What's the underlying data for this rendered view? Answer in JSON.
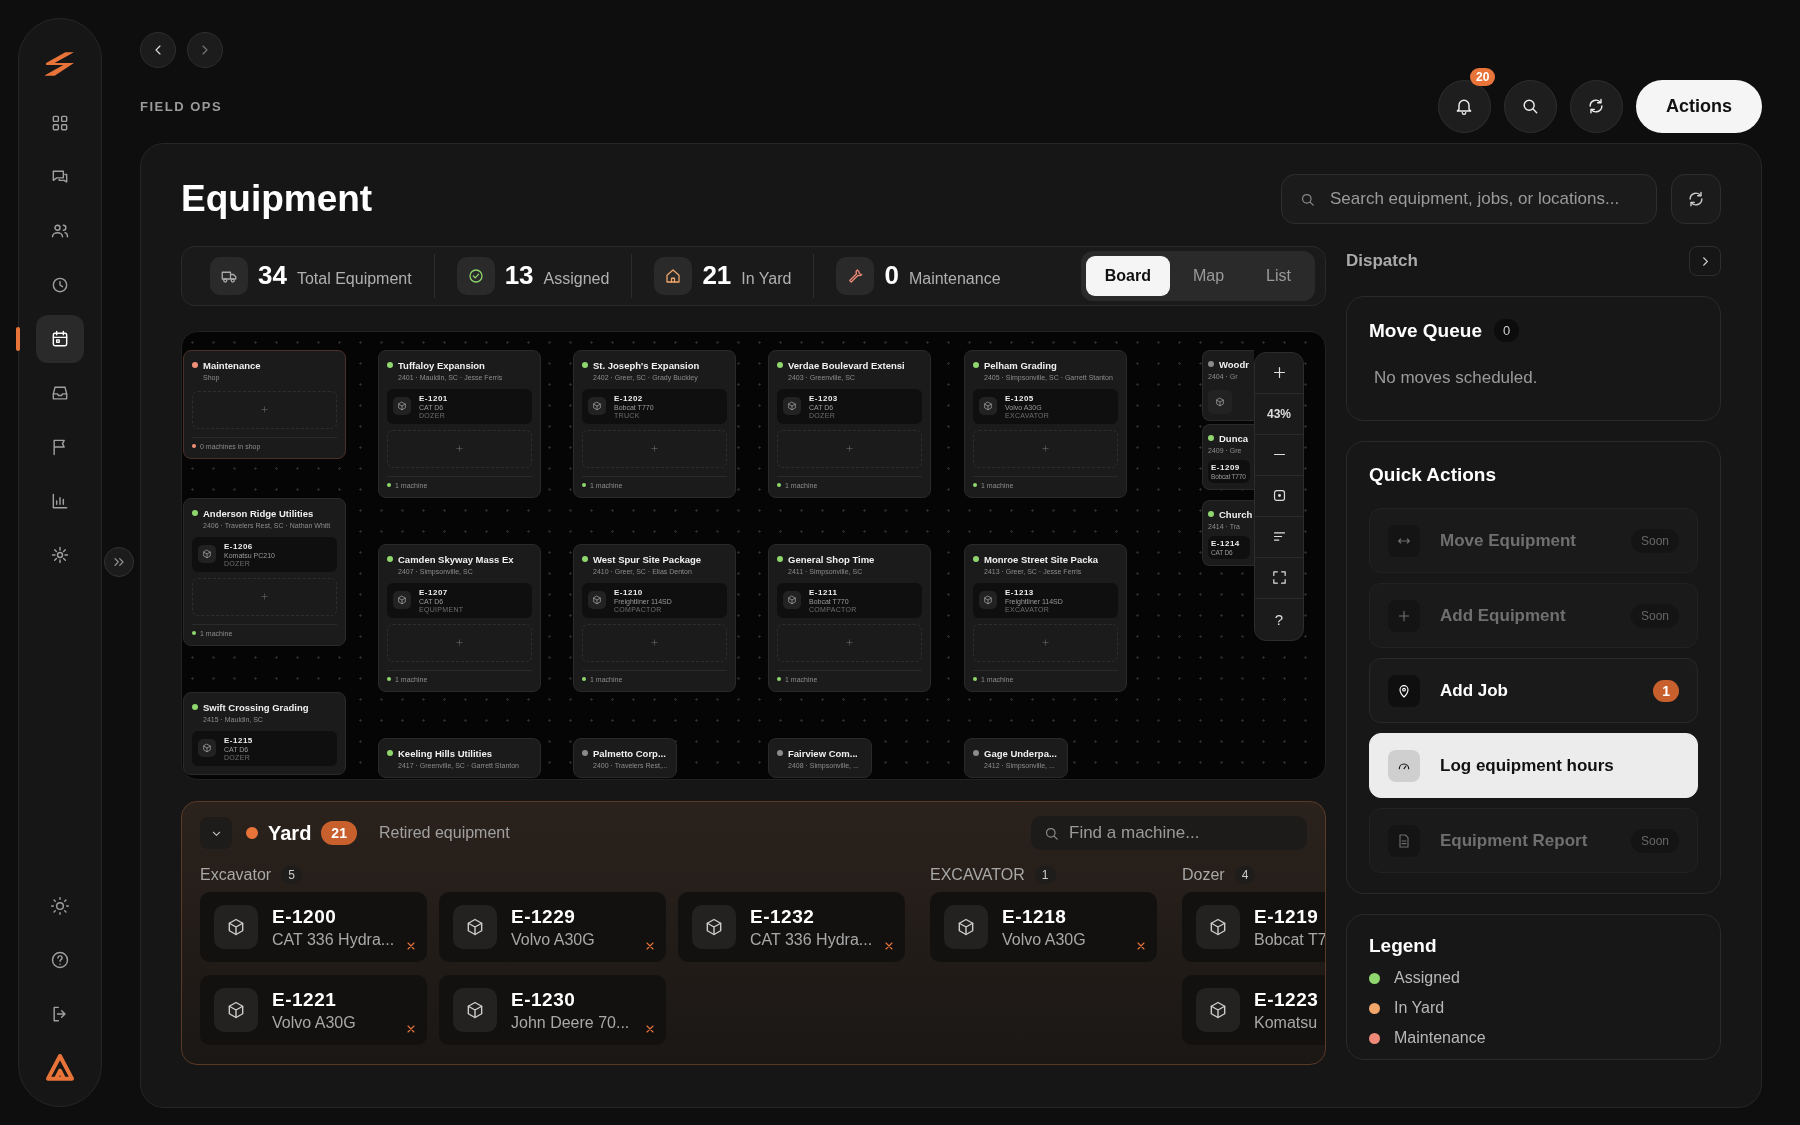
{
  "sidebar": {
    "items": [
      {
        "selected": false
      },
      {
        "selected": false
      },
      {
        "selected": false
      },
      {
        "selected": false
      },
      {
        "selected": true
      },
      {
        "selected": false
      },
      {
        "selected": false
      },
      {
        "selected": false
      },
      {
        "selected": false
      }
    ]
  },
  "section_label": "FIELD OPS",
  "header_actions": {
    "notifications_badge": "20",
    "primary_button": "Actions"
  },
  "page": {
    "title": "Equipment",
    "search": {
      "placeholder": "Search equipment, jobs, or locations..."
    }
  },
  "stats": [
    {
      "value": "34",
      "label": "Total Equipment"
    },
    {
      "value": "13",
      "label": "Assigned"
    },
    {
      "value": "21",
      "label": "In Yard"
    },
    {
      "value": "0",
      "label": "Maintenance"
    }
  ],
  "view_tabs": [
    {
      "label": "Board",
      "selected": true
    },
    {
      "label": "Map",
      "selected": false
    },
    {
      "label": "List",
      "selected": false
    }
  ],
  "board": {
    "zoom": "43%",
    "help": "?",
    "cards": [
      {
        "kind": "shop",
        "title": "Maintenance",
        "subtitle": "Shop",
        "color": "#f0907a",
        "footer": "0 machines in shop"
      },
      {
        "kind": "job",
        "title": "Tuffaloy Expansion",
        "subtitle": "2401 · Mauldin, SC · Jesse Ferris",
        "color": "#8fd66e",
        "machines": [
          {
            "id": "E-1201",
            "model": "CAT D6",
            "type": "DOZER"
          }
        ],
        "footer": "1 machine"
      },
      {
        "kind": "job",
        "title": "St. Joseph's Expansion",
        "subtitle": "2402 · Greer, SC · Grady Buckley",
        "color": "#8fd66e",
        "machines": [
          {
            "id": "E-1202",
            "model": "Bobcat T770",
            "type": "TRUCK"
          }
        ],
        "footer": "1 machine"
      },
      {
        "kind": "job",
        "title": "Verdae Boulevard Extensi",
        "subtitle": "2403 · Greenville, SC",
        "color": "#8fd66e",
        "machines": [
          {
            "id": "E-1203",
            "model": "CAT D6",
            "type": "DOZER"
          }
        ],
        "footer": "1 machine"
      },
      {
        "kind": "job",
        "title": "Pelham Grading",
        "subtitle": "2405 · Simpsonville, SC · Garrett Stanton",
        "color": "#8fd66e",
        "machines": [
          {
            "id": "E-1205",
            "model": "Volvo A30G",
            "type": "EXCAVATOR"
          }
        ],
        "footer": "1 machine"
      },
      {
        "kind": "compact",
        "title": "Woodr",
        "subtitle": "2404 · Gr",
        "color": "#8a8a8a"
      },
      {
        "kind": "job",
        "title": "Anderson Ridge Utilities",
        "subtitle": "2406 · Travelers Rest, SC · Nathan Whitt",
        "color": "#8fd66e",
        "machines": [
          {
            "id": "E-1206",
            "model": "Komatsu PC210",
            "type": "DOZER"
          }
        ],
        "footer": "1 machine"
      },
      {
        "kind": "compact",
        "title": "Dunca",
        "subtitle": "2409 · Gre",
        "color": "#8fd66e",
        "machines": [
          {
            "id": "E-1209",
            "model": "Bobcat T770"
          }
        ]
      },
      {
        "kind": "compact",
        "title": "Church",
        "subtitle": "2414 · Tra",
        "color": "#8fd66e",
        "machines": [
          {
            "id": "E-1214",
            "model": "CAT D6"
          }
        ]
      },
      {
        "kind": "job",
        "title": "Camden Skyway Mass Ex",
        "subtitle": "2407 · Simpsonville, SC",
        "color": "#8fd66e",
        "machines": [
          {
            "id": "E-1207",
            "model": "CAT D6",
            "type": "EQUIPMENT"
          }
        ],
        "footer": "1 machine"
      },
      {
        "kind": "job",
        "title": "West Spur Site Package",
        "subtitle": "2410 · Greer, SC · Elias Denton",
        "color": "#8fd66e",
        "machines": [
          {
            "id": "E-1210",
            "model": "Freightliner 114SD",
            "type": "COMPACTOR"
          }
        ],
        "footer": "1 machine"
      },
      {
        "kind": "job",
        "title": "General Shop Time",
        "subtitle": "2411 · Simpsonville, SC",
        "color": "#8fd66e",
        "machines": [
          {
            "id": "E-1211",
            "model": "Bobcat T770",
            "type": "COMPACTOR"
          }
        ],
        "footer": "1 machine"
      },
      {
        "kind": "job",
        "title": "Monroe Street Site Packa",
        "subtitle": "2413 · Greer, SC · Jesse Ferris",
        "color": "#8fd66e",
        "machines": [
          {
            "id": "E-1213",
            "model": "Freightliner 114SD",
            "type": "EXCAVATOR"
          }
        ],
        "footer": "1 machine"
      },
      {
        "kind": "stub",
        "title": "Swift Crossing Grading",
        "subtitle": "2415 · Mauldin, SC",
        "color": "#8fd66e",
        "machines": [
          {
            "id": "E-1215",
            "model": "CAT D6",
            "type": "DOZER"
          }
        ]
      },
      {
        "kind": "stub",
        "title": "Keeling Hills Utilities",
        "subtitle": "2417 · Greenville, SC · Garrett Stanton",
        "color": "#8fd66e"
      },
      {
        "kind": "stub",
        "title": "Palmetto Corp...",
        "subtitle": "2400 · Travelers Rest,...",
        "color": "#8a8a8a"
      },
      {
        "kind": "stub",
        "title": "Fairview Com...",
        "subtitle": "2408 · Simpsonville, ...",
        "color": "#8a8a8a"
      },
      {
        "kind": "stub",
        "title": "Gage Underpa...",
        "subtitle": "2412 · Simpsonville, ...",
        "color": "#8a8a8a"
      }
    ]
  },
  "yard": {
    "title": "Yard",
    "count": "21",
    "expanded": true,
    "link": "Retired equipment",
    "search": {
      "placeholder": "Find a machine..."
    },
    "groups": [
      {
        "name": "Excavator",
        "count": "5",
        "items": [
          {
            "id": "E-1200",
            "model": "CAT 336 Hydra..."
          },
          {
            "id": "E-1229",
            "model": "Volvo A30G"
          },
          {
            "id": "E-1232",
            "model": "CAT 336 Hydra..."
          },
          {
            "id": "E-1221",
            "model": "Volvo A30G"
          },
          {
            "id": "E-1230",
            "model": "John Deere 70..."
          }
        ]
      },
      {
        "name": "EXCAVATOR",
        "count": "1",
        "items": [
          {
            "id": "E-1218",
            "model": "Volvo A30G"
          }
        ]
      },
      {
        "name": "Dozer",
        "count": "4",
        "items": [
          {
            "id": "E-1219",
            "model": "Bobcat T7"
          },
          {
            "id": "E-1223",
            "model": "Komatsu"
          }
        ]
      }
    ]
  },
  "dispatch": {
    "title": "Dispatch",
    "move_queue": {
      "title": "Move Queue",
      "count": "0",
      "empty": "No moves scheduled."
    },
    "quick_actions": {
      "title": "Quick Actions",
      "items": [
        {
          "label": "Move Equipment",
          "disabled": true,
          "tag": "Soon",
          "selected": false
        },
        {
          "label": "Add Equipment",
          "disabled": true,
          "tag": "Soon",
          "selected": false
        },
        {
          "label": "Add Job",
          "disabled": false,
          "badge": "1",
          "selected": false
        },
        {
          "label": "Log equipment hours",
          "disabled": false,
          "selected": true
        },
        {
          "label": "Equipment Report",
          "disabled": true,
          "tag": "Soon",
          "selected": false
        }
      ]
    },
    "legend": {
      "title": "Legend",
      "items": [
        {
          "label": "Assigned",
          "color": "#8fd66e"
        },
        {
          "label": "In Yard",
          "color": "#f2a66a"
        },
        {
          "label": "Maintenance",
          "color": "#f08a78"
        }
      ]
    }
  }
}
